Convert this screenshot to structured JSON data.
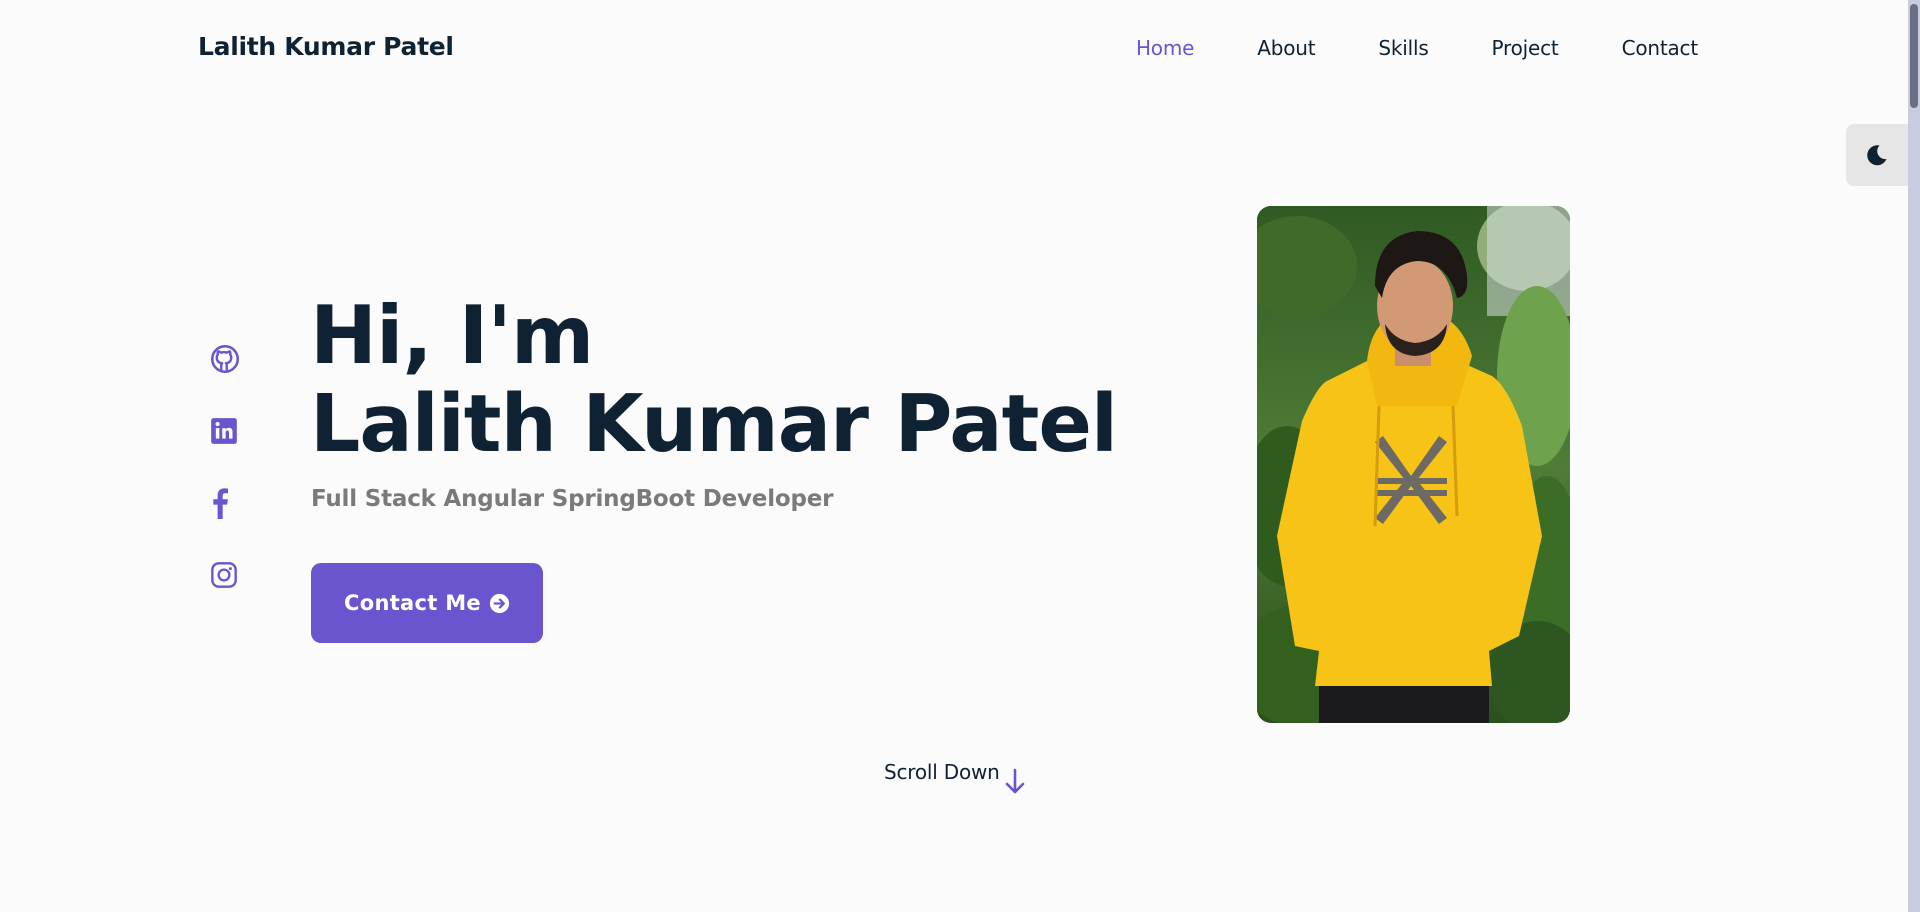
{
  "header": {
    "brand": "Lalith Kumar Patel",
    "nav": [
      {
        "label": "Home",
        "active": true
      },
      {
        "label": "About"
      },
      {
        "label": "Skills"
      },
      {
        "label": "Project"
      },
      {
        "label": "Contact"
      }
    ]
  },
  "theme_toggle": {
    "icon": "moon-icon"
  },
  "social": [
    {
      "icon": "github-icon"
    },
    {
      "icon": "linkedin-icon"
    },
    {
      "icon": "facebook-icon"
    },
    {
      "icon": "instagram-icon"
    }
  ],
  "hero": {
    "greeting": "Hi, I'm",
    "name": "Lalith Kumar Patel",
    "subtitle": "Full Stack Angular SpringBoot Developer",
    "cta_label": "Contact Me",
    "cta_icon": "arrow-right-circle-icon"
  },
  "scroll_down": {
    "label": "Scroll Down",
    "icon": "arrow-down-icon"
  },
  "colors": {
    "accent": "#6a55cf",
    "text": "#0f2233",
    "muted": "#7a7a7a",
    "background": "#fcfbfb"
  }
}
